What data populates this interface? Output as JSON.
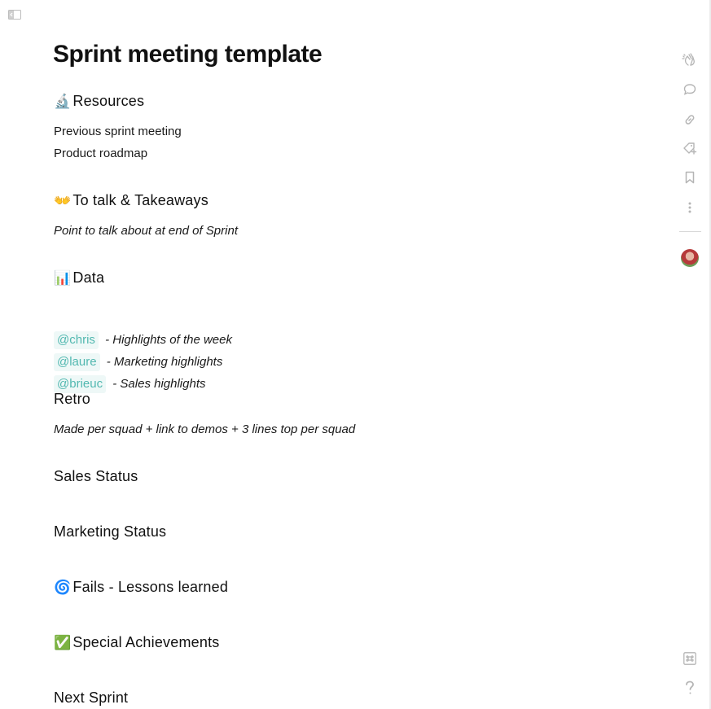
{
  "document": {
    "title": "Sprint meeting template"
  },
  "sections": {
    "resources": {
      "emoji": "🔬",
      "heading": "Resources",
      "items": [
        "Previous sprint meeting",
        "Product roadmap"
      ]
    },
    "talk": {
      "emoji": "👐",
      "heading": "To talk & Takeaways",
      "note": "Point to talk about at end of Sprint"
    },
    "data": {
      "emoji": "📊",
      "heading": "Data",
      "rows": [
        {
          "mention": "@chris",
          "text": " - Highlights of the week"
        },
        {
          "mention": "@laure",
          "text": " - Marketing highlights"
        },
        {
          "mention": "@brieuc",
          "text": " - Sales highlights"
        }
      ]
    },
    "retro": {
      "heading": "Retro",
      "note": "Made per squad + link to demos + 3 lines top per squad"
    },
    "sales": {
      "heading": "Sales Status"
    },
    "marketing": {
      "heading": "Marketing Status"
    },
    "fails": {
      "emoji": "🌀",
      "heading": "Fails - Lessons learned"
    },
    "achievements": {
      "emoji": "✅",
      "heading": "Special Achievements"
    },
    "next": {
      "heading": "Next Sprint"
    }
  },
  "right_rail": {
    "icons": [
      "clap-icon",
      "comment-icon",
      "link-icon",
      "tag-icon",
      "bookmark-icon",
      "more-icon"
    ],
    "bottom_icons": [
      "shortcuts-icon",
      "help-icon"
    ]
  },
  "colors": {
    "mention_bg": "#eef8f7",
    "mention_text": "#52b8b0",
    "icon_gray": "#b5b5b5"
  }
}
